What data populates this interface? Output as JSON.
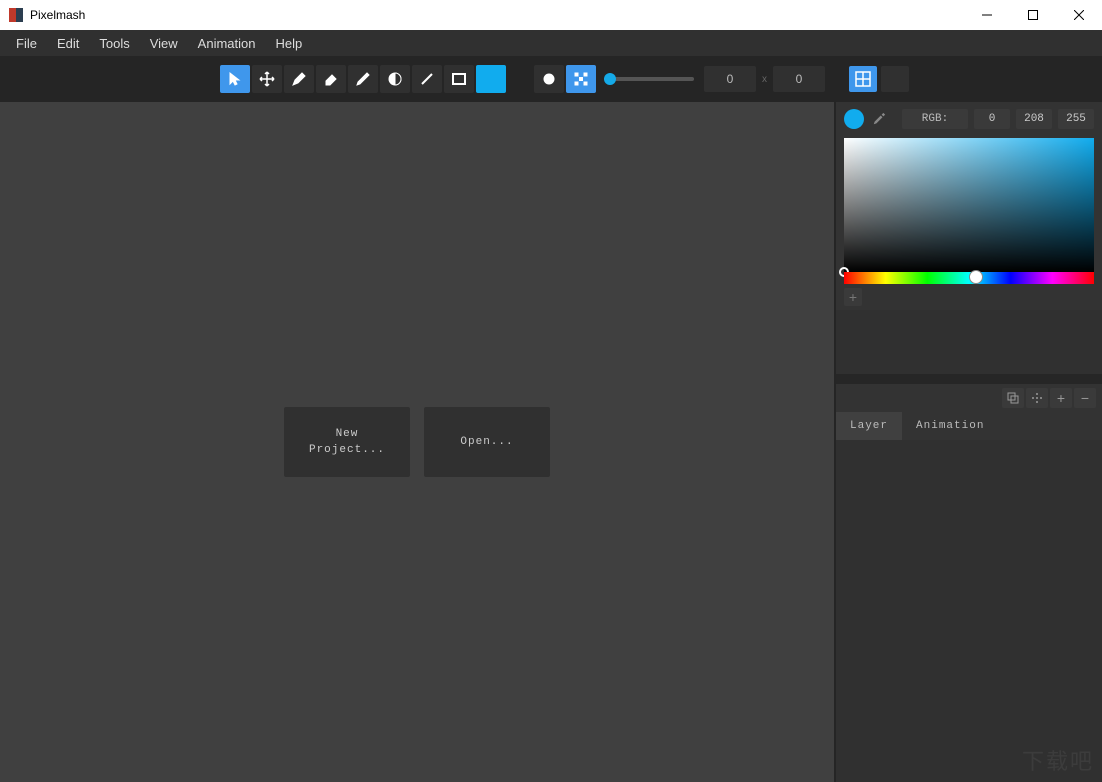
{
  "title": "Pixelmash",
  "menu": {
    "file": "File",
    "edit": "Edit",
    "tools": "Tools",
    "view": "View",
    "animation": "Animation",
    "help": "Help"
  },
  "toolbar": {
    "dim_x": "0",
    "dim_y": "0",
    "times": "x",
    "swatch_color": "#11acee"
  },
  "canvas": {
    "new_project": "New\nProject...",
    "open": "Open..."
  },
  "color_panel": {
    "current_color": "#11acee",
    "rgb_label": "RGB:",
    "r": "0",
    "g": "208",
    "b": "255"
  },
  "tabs": {
    "layer": "Layer",
    "animation": "Animation"
  },
  "watermark": "下载吧"
}
